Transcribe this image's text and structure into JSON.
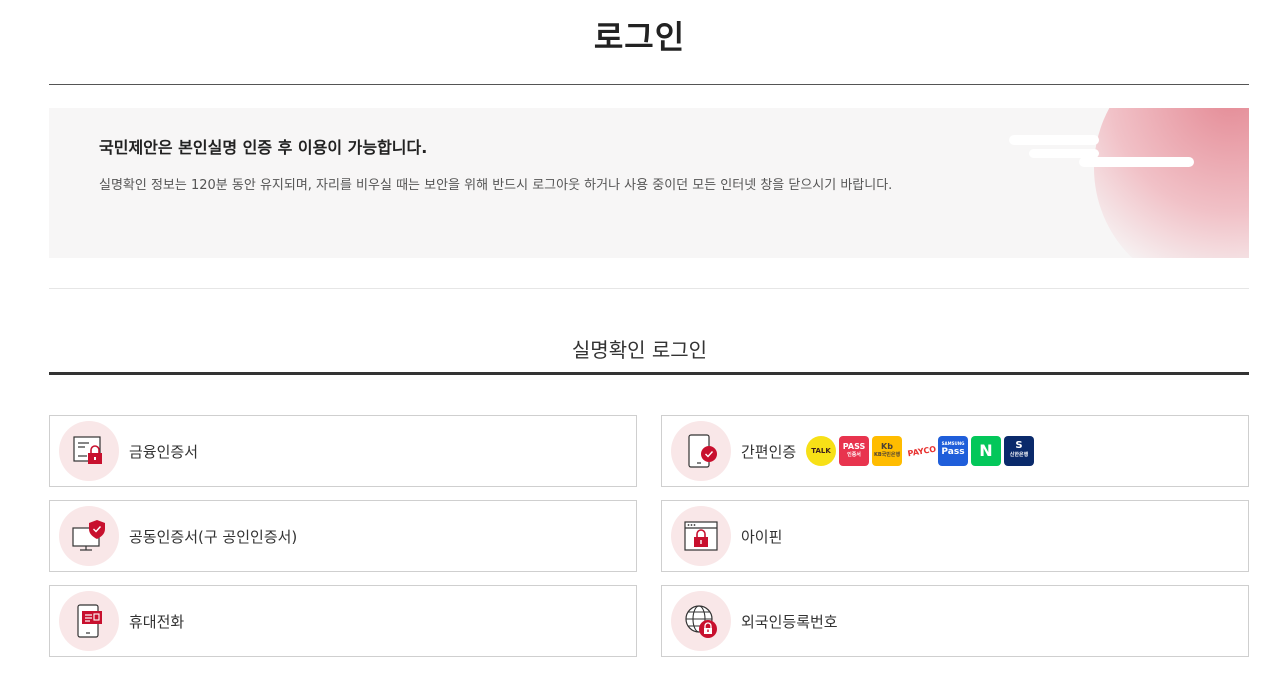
{
  "page": {
    "title": "로그인"
  },
  "notice": {
    "headline": "국민제안은 본인실명 인증 후 이용이 가능합니다.",
    "description": "실명확인 정보는 120분 동안 유지되며, 자리를 비우실 때는 보안을 위해 반드시 로그아웃 하거나 사용 중이던 모든 인터넷 창을 닫으시기 바랍니다."
  },
  "section": {
    "title": "실명확인 로그인"
  },
  "methods": [
    {
      "label": "금융인증서",
      "icon": "financial-certificate-icon"
    },
    {
      "label": "공동인증서(구 공인인증서)",
      "icon": "joint-certificate-icon"
    },
    {
      "label": "휴대전화",
      "icon": "mobile-phone-icon"
    },
    {
      "label": "간편인증",
      "icon": "simple-auth-phone-icon"
    },
    {
      "label": "아이핀",
      "icon": "ipin-icon"
    },
    {
      "label": "외국인등록번호",
      "icon": "globe-lock-icon"
    }
  ],
  "providers": {
    "kakao": {
      "text": "TALK"
    },
    "pass": {
      "text": "PASS",
      "sub": "인증서"
    },
    "kb": {
      "text": "Kb",
      "sub": "KB국민은행"
    },
    "payco": {
      "text": "PAYCO"
    },
    "samsung": {
      "text": "SAMSUNG",
      "sub": "Pass"
    },
    "naver": {
      "text": "N"
    },
    "shinhan": {
      "text": "S",
      "sub": "신한은행"
    }
  },
  "colors": {
    "accent": "#c8102e",
    "icon_bg": "#f9e7e8",
    "notice_bg": "#f7f6f6"
  }
}
